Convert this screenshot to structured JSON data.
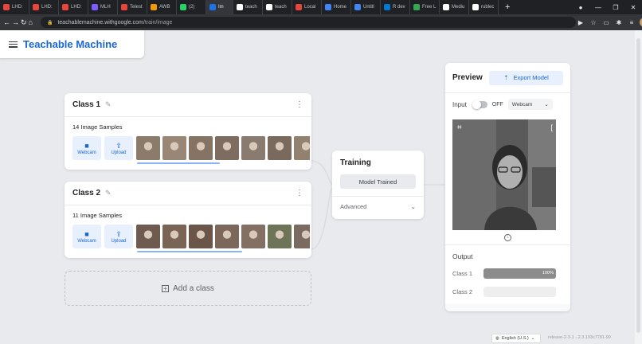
{
  "browser": {
    "tabs": [
      {
        "label": "LHD:",
        "color": "#e8453c"
      },
      {
        "label": "LHD:",
        "color": "#e8453c"
      },
      {
        "label": "LHD:",
        "color": "#e8453c"
      },
      {
        "label": "MLH",
        "color": "#7b5cff"
      },
      {
        "label": "Telest",
        "color": "#e8453c"
      },
      {
        "label": "AWB",
        "color": "#f29900"
      },
      {
        "label": "(2)",
        "color": "#25d366"
      },
      {
        "label": "Im",
        "color": "#1a73e8",
        "active": true
      },
      {
        "label": "teach",
        "color": "#ffffff"
      },
      {
        "label": "teach",
        "color": "#ffffff"
      },
      {
        "label": "Local",
        "color": "#e8453c"
      },
      {
        "label": "Home",
        "color": "#4285f4"
      },
      {
        "label": "Untitl",
        "color": "#4285f4"
      },
      {
        "label": "R dev",
        "color": "#0079d3"
      },
      {
        "label": "Free L",
        "color": "#34a853"
      },
      {
        "label": "Mediu",
        "color": "#ffffff"
      },
      {
        "label": "rublec",
        "color": "#ffffff"
      }
    ],
    "new_tab": "+",
    "url_host": "teachablemachine.withgoogle.com",
    "url_path": "/train/image"
  },
  "app": {
    "brand": "Teachable Machine"
  },
  "classes": [
    {
      "title": "Class 1",
      "samples": "14 Image Samples",
      "webcam_label": "Webcam",
      "upload_label": "Upload",
      "thumb_colors": [
        "#8c7a6b",
        "#9a8674",
        "#857364",
        "#7d6c5f",
        "#8a7b70",
        "#7a6a5e",
        "#938170"
      ]
    },
    {
      "title": "Class 2",
      "samples": "11 Image Samples",
      "webcam_label": "Webcam",
      "upload_label": "Upload",
      "thumb_colors": [
        "#6e5a4e",
        "#7a6456",
        "#6a5548",
        "#7d675a",
        "#837063",
        "#6d7458",
        "#7b6a60"
      ]
    }
  ],
  "add_class": "Add a class",
  "training": {
    "title": "Training",
    "button": "Model Trained",
    "advanced": "Advanced"
  },
  "preview": {
    "title": "Preview",
    "export": "Export Model",
    "input_label": "Input",
    "toggle_state": "OFF",
    "source": "Webcam",
    "output_label": "Output",
    "outputs": [
      {
        "label": "Class 1",
        "value": 1.0,
        "text": "100%"
      },
      {
        "label": "Class 2",
        "value": 0.0,
        "text": ""
      }
    ]
  },
  "footer": {
    "language": "English (U.S.)",
    "release": "release-2-3-1 - 2.3.193c7781-99"
  },
  "colors": {
    "brand": "#1967d2",
    "accent_bg": "#e8f0fe"
  }
}
